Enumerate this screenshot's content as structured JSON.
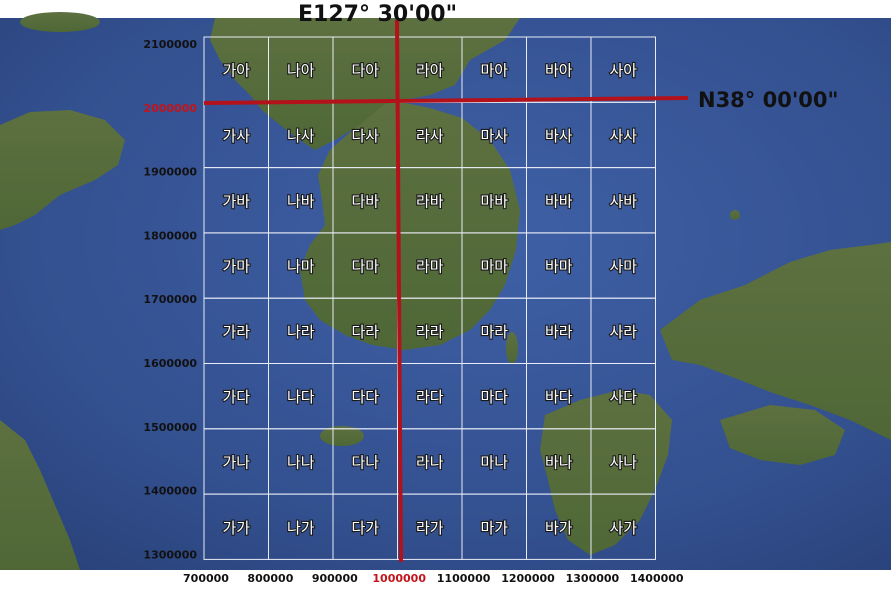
{
  "meridian_label": "E127°  30'00\"",
  "parallel_label": "N38°  00'00\"",
  "y_ticks": [
    "2100000",
    "2000000",
    "1900000",
    "1800000",
    "1700000",
    "1600000",
    "1500000",
    "1400000",
    "1300000"
  ],
  "y_tick_highlight": "2000000",
  "x_ticks": [
    "700000",
    "800000",
    "900000",
    "1000000",
    "1100000",
    "1200000",
    "1300000",
    "1400000"
  ],
  "x_tick_highlight": "1000000",
  "grid_rows": [
    [
      "가아",
      "나아",
      "다아",
      "라아",
      "마아",
      "바아",
      "사아"
    ],
    [
      "가사",
      "나사",
      "다사",
      "라사",
      "마사",
      "바사",
      "사사"
    ],
    [
      "가바",
      "나바",
      "다바",
      "라바",
      "마바",
      "바바",
      "사바"
    ],
    [
      "가마",
      "나마",
      "다마",
      "라마",
      "마마",
      "바마",
      "사마"
    ],
    [
      "가라",
      "나라",
      "다라",
      "라라",
      "마라",
      "바라",
      "사라"
    ],
    [
      "가다",
      "나다",
      "다다",
      "라다",
      "마다",
      "바다",
      "사다"
    ],
    [
      "가나",
      "나나",
      "다나",
      "라나",
      "마나",
      "바나",
      "사나"
    ],
    [
      "가가",
      "나가",
      "다가",
      "라가",
      "마가",
      "바가",
      "사가"
    ]
  ],
  "colors": {
    "sea": "#3d5a9c",
    "land": "#5f7340",
    "grid_line": "#e8ecf5",
    "red_line": "#b3121b",
    "tick_highlight": "#c3141b"
  }
}
